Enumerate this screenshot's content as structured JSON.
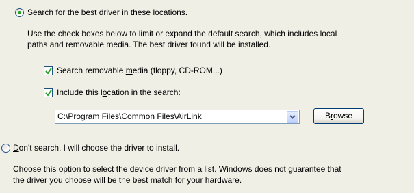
{
  "option_search": {
    "selected": true,
    "label_prefix": "",
    "label_mnemonic": "S",
    "label_rest": "earch for the best driver in these locations.",
    "description_line1": "Use the check boxes below to limit or expand the default search, which includes local",
    "description_line2": "paths and removable media. The best driver found will be installed."
  },
  "checkbox_removable": {
    "checked": true,
    "label_prefix": "Search removable ",
    "label_mnemonic": "m",
    "label_rest": "edia (floppy, CD-ROM...)"
  },
  "checkbox_location": {
    "checked": true,
    "label_prefix": "Include this l",
    "label_mnemonic": "o",
    "label_rest": "cation in the search:"
  },
  "location_combo": {
    "value": "C:\\Program Files\\Common Files\\AirLink",
    "icon": "chevron-down-icon"
  },
  "browse_button": {
    "label_prefix": "B",
    "label_mnemonic": "r",
    "label_rest": "owse"
  },
  "option_dont_search": {
    "selected": false,
    "label_prefix": "",
    "label_mnemonic": "D",
    "label_rest": "on't search. I will choose the driver to install.",
    "description_line1": "Choose this option to select the device driver from a list.  Windows does not guarantee that",
    "description_line2": "the driver you choose will be the best match for your hardware."
  },
  "colors": {
    "panel_background": "#f0efe6",
    "radio_dot": "#21a121",
    "check_mark": "#21a121",
    "control_border": "#1c5180",
    "combo_border": "#7f9db9",
    "button_border": "#003c74"
  }
}
